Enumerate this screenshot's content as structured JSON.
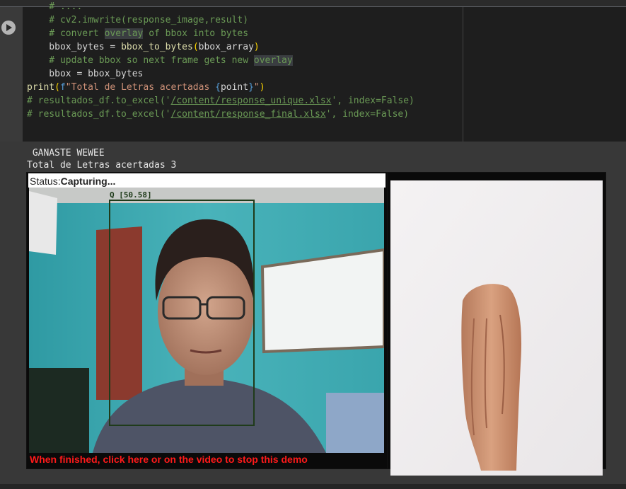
{
  "code": {
    "line_top": "    # ....",
    "line1_comment": "    # cv2.imwrite(response_image,result)",
    "line2_pre": "    # convert ",
    "line2_hl": "overlay",
    "line2_post": " of bbox into bytes",
    "line3_var": "    bbox_bytes = ",
    "line3_fn": "bbox_to_bytes",
    "line3_arg": "bbox_array",
    "line4_pre": "    # update bbox so next frame gets new ",
    "line4_hl": "overlay",
    "line5": "    bbox = bbox_bytes",
    "line6_fn": "print",
    "line6_f": "f",
    "line6_str": "\"Total de Letras acertadas ",
    "line6_var": "point",
    "line6_end": "\"",
    "line7_pre": "# resultados_df.to_excel('",
    "line7_path": "/content/response_unique.xlsx",
    "line7_post": "', index=False)",
    "line8_pre": "# resultados_df.to_excel('",
    "line8_path": "/content/response_final.xlsx",
    "line8_post": "', index=False)"
  },
  "output": {
    "line1": " GANASTE WEWEE",
    "line2": "Total de Letras acertadas 3",
    "status_label": "Status:",
    "status_value": "Capturing...",
    "bbox_label": "Q [50.58]",
    "finish_text": "When finished, click here or on the video to stop this demo"
  },
  "colors": {
    "finish_text": "#ff1a1a",
    "bbox": "#1f3b1a",
    "editor_bg": "#1e1e1e",
    "output_bg": "#383838"
  },
  "icons": {
    "run": "play-circle-icon"
  }
}
